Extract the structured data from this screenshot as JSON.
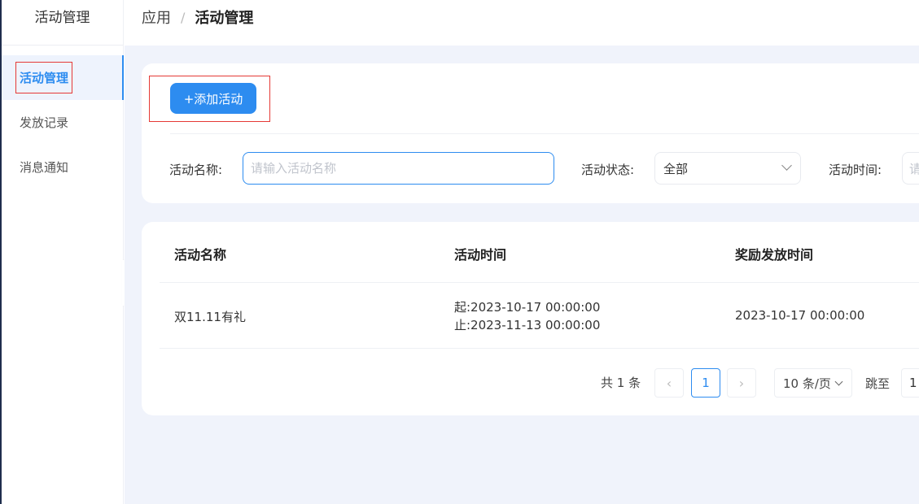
{
  "sidebar": {
    "title": "活动管理",
    "items": [
      {
        "label": "活动管理",
        "active": true
      },
      {
        "label": "发放记录",
        "active": false
      },
      {
        "label": "消息通知",
        "active": false
      }
    ]
  },
  "breadcrumb": {
    "root": "应用",
    "separator": "/",
    "current": "活动管理"
  },
  "toolbar": {
    "add_label": "+添加活动"
  },
  "filters": {
    "name_label": "活动名称:",
    "name_placeholder": "请输入活动名称",
    "status_label": "活动状态:",
    "status_value": "全部",
    "time_label": "活动时间:",
    "time_placeholder": "请"
  },
  "table": {
    "columns": [
      "活动名称",
      "活动时间",
      "奖励发放时间"
    ],
    "rows": [
      {
        "name": "双11.11有礼",
        "start": "起:2023-10-17 00:00:00",
        "end": "止:2023-11-13 00:00:00",
        "reward_time": "2023-10-17 00:00:00"
      }
    ]
  },
  "pagination": {
    "total": "共 1 条",
    "prev": "‹",
    "current_page": "1",
    "next": "›",
    "page_size": "10 条/页",
    "jump_label": "跳至",
    "jump_value": "1"
  },
  "colors": {
    "accent": "#2d8cf0",
    "highlight_border": "#e53935",
    "content_bg": "#f0f3fb"
  }
}
